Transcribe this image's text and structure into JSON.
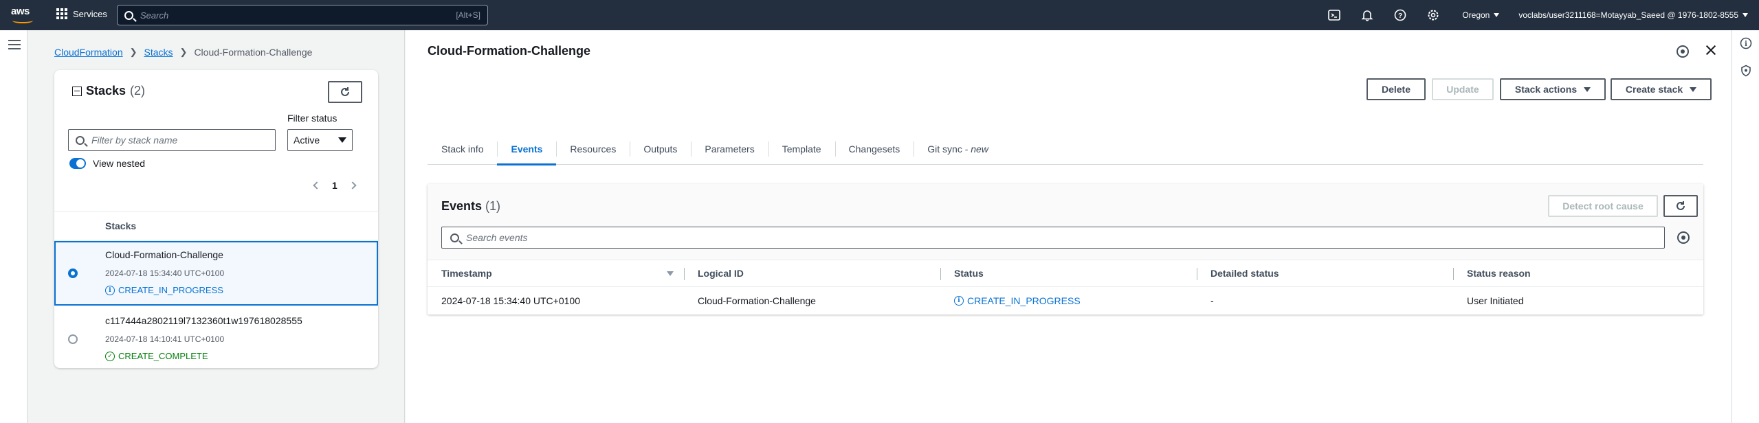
{
  "topnav": {
    "logo": "aws",
    "services_label": "Services",
    "search_placeholder": "Search",
    "search_shortcut": "[Alt+S]",
    "region": "Oregon",
    "account": "voclabs/user3211168=Motayyab_Saeed @ 1976-1802-8555",
    "icons": [
      "cloudshell-icon",
      "bell-icon",
      "help-icon",
      "settings-icon"
    ]
  },
  "breadcrumb": {
    "items": [
      "CloudFormation",
      "Stacks",
      "Cloud-Formation-Challenge"
    ]
  },
  "stacks_panel": {
    "title": "Stacks",
    "count": "(2)",
    "filter_placeholder": "Filter by stack name",
    "filter_status_label": "Filter status",
    "filter_status_value": "Active",
    "view_nested_label": "View nested",
    "page": "1",
    "column_header": "Stacks",
    "rows": [
      {
        "name": "Cloud-Formation-Challenge",
        "time": "2024-07-18 15:34:40 UTC+0100",
        "status": "CREATE_IN_PROGRESS",
        "selected": true
      },
      {
        "name": "c117444a2802119l7132360t1w197618028555",
        "time": "2024-07-18 14:10:41 UTC+0100",
        "status": "CREATE_COMPLETE",
        "selected": false
      }
    ]
  },
  "main": {
    "title": "Cloud-Formation-Challenge",
    "buttons": {
      "delete": "Delete",
      "update": "Update",
      "stack_actions": "Stack actions",
      "create_stack": "Create stack"
    },
    "tabs": [
      {
        "label": "Stack info",
        "active": false
      },
      {
        "label": "Events",
        "active": true
      },
      {
        "label": "Resources",
        "active": false
      },
      {
        "label": "Outputs",
        "active": false
      },
      {
        "label": "Parameters",
        "active": false
      },
      {
        "label": "Template",
        "active": false
      },
      {
        "label": "Changesets",
        "active": false
      },
      {
        "label": "Git sync - ",
        "suffix": "new",
        "active": false
      }
    ],
    "events": {
      "title": "Events",
      "count": "(1)",
      "detect_root_cause": "Detect root cause",
      "search_placeholder": "Search events",
      "columns": [
        "Timestamp",
        "Logical ID",
        "Status",
        "Detailed status",
        "Status reason"
      ],
      "rows": [
        {
          "timestamp": "2024-07-18 15:34:40 UTC+0100",
          "logical_id": "Cloud-Formation-Challenge",
          "status": "CREATE_IN_PROGRESS",
          "detailed_status": "-",
          "status_reason": "User Initiated"
        }
      ]
    }
  },
  "colors": {
    "nav_bg": "#232f3e",
    "link": "#0972d3",
    "success": "#037f0c",
    "aws_orange": "#ff9900"
  }
}
